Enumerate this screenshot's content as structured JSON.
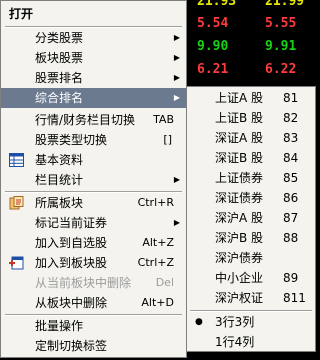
{
  "background_quotes": [
    {
      "a": "21.93",
      "b": "21.99",
      "ca": "y",
      "cb": "y"
    },
    {
      "a": "5.54",
      "b": "5.55",
      "ca": "r",
      "cb": "r"
    },
    {
      "a": "9.90",
      "b": "9.91",
      "ca": "g",
      "cb": "g"
    },
    {
      "a": "6.21",
      "b": "6.22",
      "ca": "r",
      "cb": "r"
    }
  ],
  "menu": {
    "open": "打开",
    "category_stocks": "分类股票",
    "sector_stocks": "板块股票",
    "stock_ranking": "股票排名",
    "composite_ranking": "综合排名",
    "quote_finance_switch": "行情/财务栏目切换",
    "quote_finance_switch_sc": "TAB",
    "stock_type_switch": "股票类型切换",
    "stock_type_switch_sc": "[]",
    "basic_info": "基本资料",
    "column_stats": "栏目统计",
    "belonging_sector": "所属板块",
    "belonging_sector_sc": "Ctrl+R",
    "mark_security": "标记当前证券",
    "add_to_watchlist": "加入到自选股",
    "add_to_watchlist_sc": "Alt+Z",
    "add_to_sector": "加入到板块股",
    "add_to_sector_sc": "Ctrl+Z",
    "delete_from_current": "从当前板块中删除",
    "delete_from_current_sc": "Del",
    "delete_from_sector": "从板块中删除",
    "delete_from_sector_sc": "Alt+D",
    "batch_ops": "批量操作",
    "custom_tabs": "定制切换标签"
  },
  "submenu": {
    "items": [
      {
        "label": "上证A 股",
        "code": "81"
      },
      {
        "label": "上证B 股",
        "code": "82"
      },
      {
        "label": "深证A 股",
        "code": "83"
      },
      {
        "label": "深证B 股",
        "code": "84"
      },
      {
        "label": "上证债券",
        "code": "85"
      },
      {
        "label": "深证债券",
        "code": "86"
      },
      {
        "label": "深沪A 股",
        "code": "87"
      },
      {
        "label": "深沪B 股",
        "code": "88"
      },
      {
        "label": "深沪债券",
        "code": ""
      },
      {
        "label": "中小企业",
        "code": "89"
      },
      {
        "label": "深沪权证",
        "code": "811"
      }
    ],
    "layout_3x3": "3行3列",
    "layout_1x4": "1行4列"
  }
}
